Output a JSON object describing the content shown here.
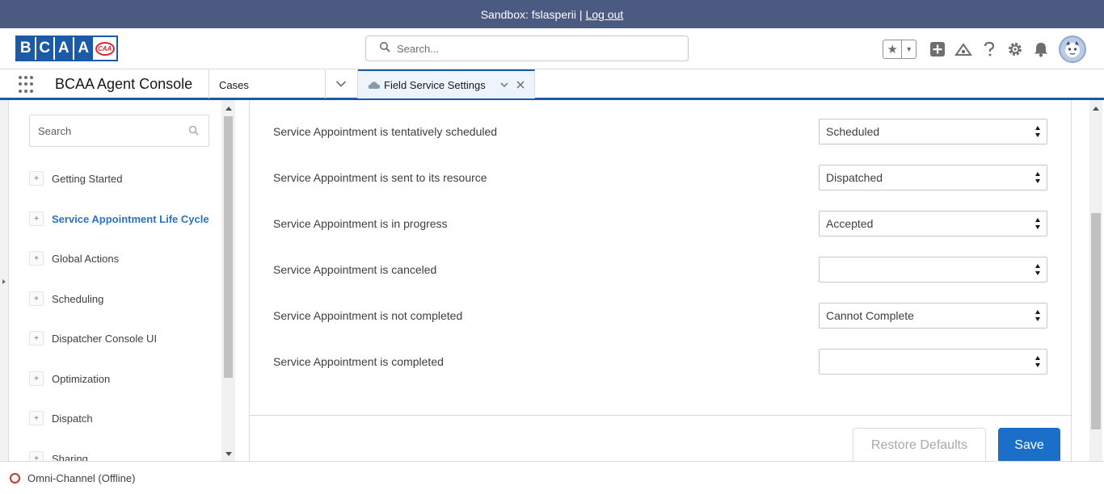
{
  "sandbox": {
    "text": "Sandbox: fslasperii |",
    "logout": "Log out"
  },
  "logo": {
    "letters": [
      "B",
      "C",
      "A",
      "A"
    ],
    "badge": "CAA"
  },
  "search": {
    "placeholder": "Search..."
  },
  "header_icons": [
    "star-icon",
    "chevron-down-icon",
    "add-icon",
    "trailhead-icon",
    "help-icon",
    "gear-icon",
    "bell-icon",
    "avatar"
  ],
  "nav": {
    "app_name": "BCAA Agent Console",
    "object_tab": "Cases",
    "active_tab": "Field Service Settings"
  },
  "sidebar": {
    "search_placeholder": "Search",
    "items": [
      {
        "label": "Getting Started",
        "active": false
      },
      {
        "label": "Service Appointment Life Cycle",
        "active": true
      },
      {
        "label": "Global Actions",
        "active": false
      },
      {
        "label": "Scheduling",
        "active": false
      },
      {
        "label": "Dispatcher Console UI",
        "active": false
      },
      {
        "label": "Optimization",
        "active": false
      },
      {
        "label": "Dispatch",
        "active": false
      },
      {
        "label": "Sharing",
        "active": false
      }
    ]
  },
  "settings": {
    "rows": [
      {
        "label": "Service Appointment is tentatively scheduled",
        "value": "Scheduled"
      },
      {
        "label": "Service Appointment is sent to its resource",
        "value": "Dispatched"
      },
      {
        "label": "Service Appointment is in progress",
        "value": "Accepted"
      },
      {
        "label": "Service Appointment is canceled",
        "value": ""
      },
      {
        "label": "Service Appointment is not completed",
        "value": "Cannot Complete"
      },
      {
        "label": "Service Appointment is completed",
        "value": ""
      }
    ],
    "restore_label": "Restore Defaults",
    "save_label": "Save"
  },
  "utility": {
    "omni_label": "Omni-Channel (Offline)"
  },
  "colors": {
    "brand": "#1b5aa6",
    "sandbox_bar": "#4a5a80",
    "save_button": "#1b6fc8",
    "active_link": "#2b72c0",
    "offline": "#c23934"
  }
}
